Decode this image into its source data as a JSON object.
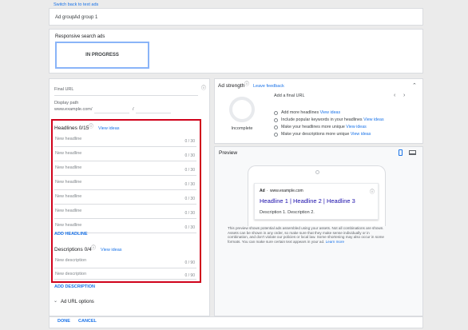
{
  "top_link": "Switch back to text ads",
  "ad_group": {
    "label": "Ad group:",
    "value": "Ad group 1"
  },
  "rsa": {
    "title": "Responsive search ads",
    "status_box": "IN PROGRESS"
  },
  "form": {
    "final_url_label": "Final URL",
    "display_path_label": "Display path",
    "display_path_base": "www.example.com",
    "display_path_sep1": "/",
    "display_path_sep2": "/",
    "headlines_title": "Headlines 0/15",
    "headlines_view_ideas": "View ideas",
    "headlines": [
      {
        "placeholder": "New headline",
        "counter": "0 / 30"
      },
      {
        "placeholder": "New headline",
        "counter": "0 / 30"
      },
      {
        "placeholder": "New headline",
        "counter": "0 / 30"
      },
      {
        "placeholder": "New headline",
        "counter": "0 / 30"
      },
      {
        "placeholder": "New headline",
        "counter": "0 / 30"
      },
      {
        "placeholder": "New headline",
        "counter": "0 / 30"
      },
      {
        "placeholder": "New headline",
        "counter": "0 / 30"
      }
    ],
    "add_headline": "ADD HEADLINE",
    "descriptions_title": "Descriptions 0/4",
    "descriptions_view_ideas": "View ideas",
    "descriptions": [
      {
        "placeholder": "New description",
        "counter": "0 / 90"
      },
      {
        "placeholder": "New description",
        "counter": "0 / 90"
      }
    ],
    "add_description": "ADD DESCRIPTION",
    "ad_url_options": "Ad URL options"
  },
  "ad_strength": {
    "title": "Ad strength",
    "leave_feedback": "Leave feedback",
    "rating": "Incomplete",
    "hint": "Add a final URL",
    "tips": [
      {
        "text": "Add more headlines",
        "link": "View ideas"
      },
      {
        "text": "Include popular keywords in your headlines",
        "link": "View ideas"
      },
      {
        "text": "Make your headlines more unique",
        "link": "View ideas"
      },
      {
        "text": "Make your descriptions more unique",
        "link": "View ideas"
      }
    ]
  },
  "preview": {
    "title": "Preview",
    "ad_badge": "Ad",
    "ad_url": "www.example.com",
    "ad_headline": "Headline 1 | Headline 2 | Headline 3",
    "ad_description": "Description 1. Description 2.",
    "disclaimer_lines": [
      "This preview shows potential ads assembled using your assets. Not all combinations are shown.",
      "Assets can be shown in any order, so make sure that they make sense individually or in",
      "combination, and don't violate our policies or local law. Some shortening may also occur in some",
      "formats. You can make sure certain text appears in your ad."
    ],
    "learn_more": "Learn more"
  },
  "footer": {
    "done": "DONE",
    "cancel": "CANCEL"
  }
}
